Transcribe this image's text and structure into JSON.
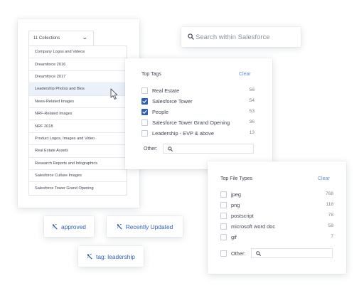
{
  "collections": {
    "dropdown_label": "11 Collections",
    "items": [
      "Company Logos and Videos",
      "Dreamforce 2016",
      "Dreamforce 2017",
      "Leadership Photos and Bios",
      "News-Related Images",
      "NRF-Related Images",
      "NRF 2018",
      "Product Logos, Images and Video",
      "Real Estate Assets",
      "Research Reports and Infographics",
      "Salesforce Culture Images",
      "Salesforce Tower Grand Opening"
    ],
    "highlighted_item": "Leadership Photos and Bios"
  },
  "search": {
    "placeholder": "Search within Salesforce",
    "icon": "search-icon"
  },
  "top_tags": {
    "title": "Top Tags",
    "clear_label": "Clear",
    "other_label": "Other:",
    "items": [
      {
        "label": "Real Estate",
        "count": "56",
        "checked": false
      },
      {
        "label": "Salesforce Tower",
        "count": "54",
        "checked": true
      },
      {
        "label": "People",
        "count": "53",
        "checked": true
      },
      {
        "label": "Salesforce Tower Grand Opening",
        "count": "36",
        "checked": false
      },
      {
        "label": "Leadership - EVP & above",
        "count": "13",
        "checked": false
      }
    ]
  },
  "file_types": {
    "title": "Top File Types",
    "clear_label": "Clear",
    "other_label": "Other:",
    "items": [
      {
        "label": "jpeg",
        "count": "768",
        "checked": false
      },
      {
        "label": "png",
        "count": "118",
        "checked": false
      },
      {
        "label": "postscript",
        "count": "78",
        "checked": false
      },
      {
        "label": "microsoft word doc",
        "count": "58",
        "checked": false
      },
      {
        "label": "gif",
        "count": "7",
        "checked": false
      }
    ]
  },
  "chips": {
    "approved": "approved",
    "recently_updated": "Recently Updated",
    "tag": "tag: leadership"
  },
  "colors": {
    "accent": "#2f5fb5",
    "link": "#5b8ed8",
    "text": "#3f4652",
    "muted": "#7d8590",
    "highlight_row": "#eaf1fb"
  }
}
